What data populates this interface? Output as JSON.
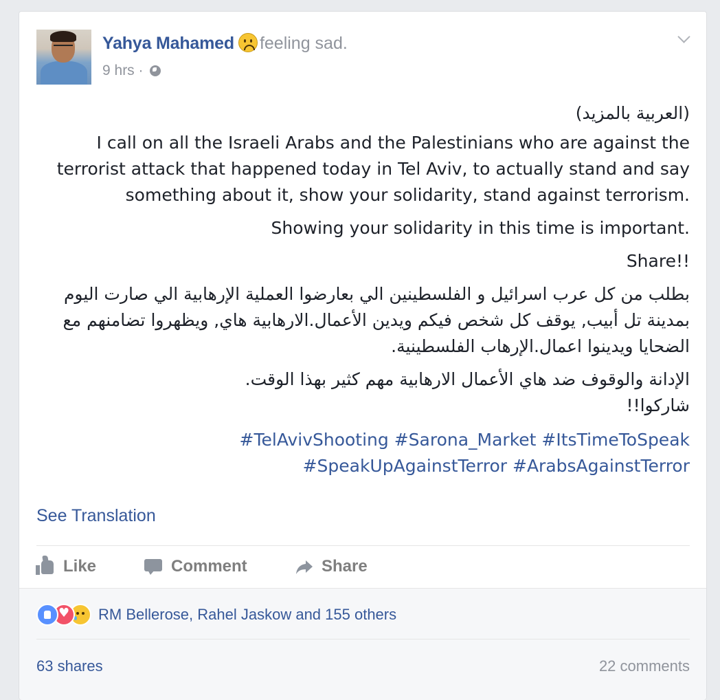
{
  "post": {
    "author": "Yahya Mahamed",
    "feeling": "feeling sad.",
    "feeling_icon": "sad-face-icon",
    "timestamp": "9 hrs",
    "separator": "·",
    "privacy_icon": "globe-icon",
    "body": {
      "arabic_heading": "(العربية بالمزيد)",
      "english_paragraph": "I call on all the Israeli Arabs and the Palestinians who are against the terrorist attack that happened today in Tel Aviv, to actually stand and say something about it, show your solidarity, stand against terrorism.",
      "english_line_2": "Showing your solidarity in this time is important.",
      "english_line_3": "Share!!",
      "arabic_paragraph": "بطلب من كل عرب اسرائيل و الفلسطينين الي بعارضوا العملية الإرهابية الي صارت اليوم بمدينة تل أبيب, يوقف كل شخص فيكم ويدين الأعمال.الارهابية هاي, ويظهروا تضامنهم مع الضحايا ويدينوا اعمال.الإرهاب الفلسطينية.",
      "arabic_line_2": "الإدانة والوقوف ضد هاي الأعمال الارهابية مهم كثير بهذا الوقت.",
      "arabic_line_3": "شاركوا!!",
      "hashtags_line_1": "#TelAvivShooting #Sarona_Market #ItsTimeToSpeak",
      "hashtags_line_2": "#SpeakUpAgainstTerror #ArabsAgainstTerror"
    },
    "see_translation": "See Translation"
  },
  "actions": {
    "like": "Like",
    "comment": "Comment",
    "share": "Share"
  },
  "footer": {
    "reactions_text": "RM Bellerose, Rahel Jaskow and 155 others",
    "shares": "63 shares",
    "comments": "22 comments"
  },
  "colors": {
    "link": "#365899",
    "muted": "#90949c",
    "text": "#1d2129",
    "like_reaction": "#5890ff",
    "love_reaction": "#f25268",
    "sad_reaction": "#f7c532"
  }
}
